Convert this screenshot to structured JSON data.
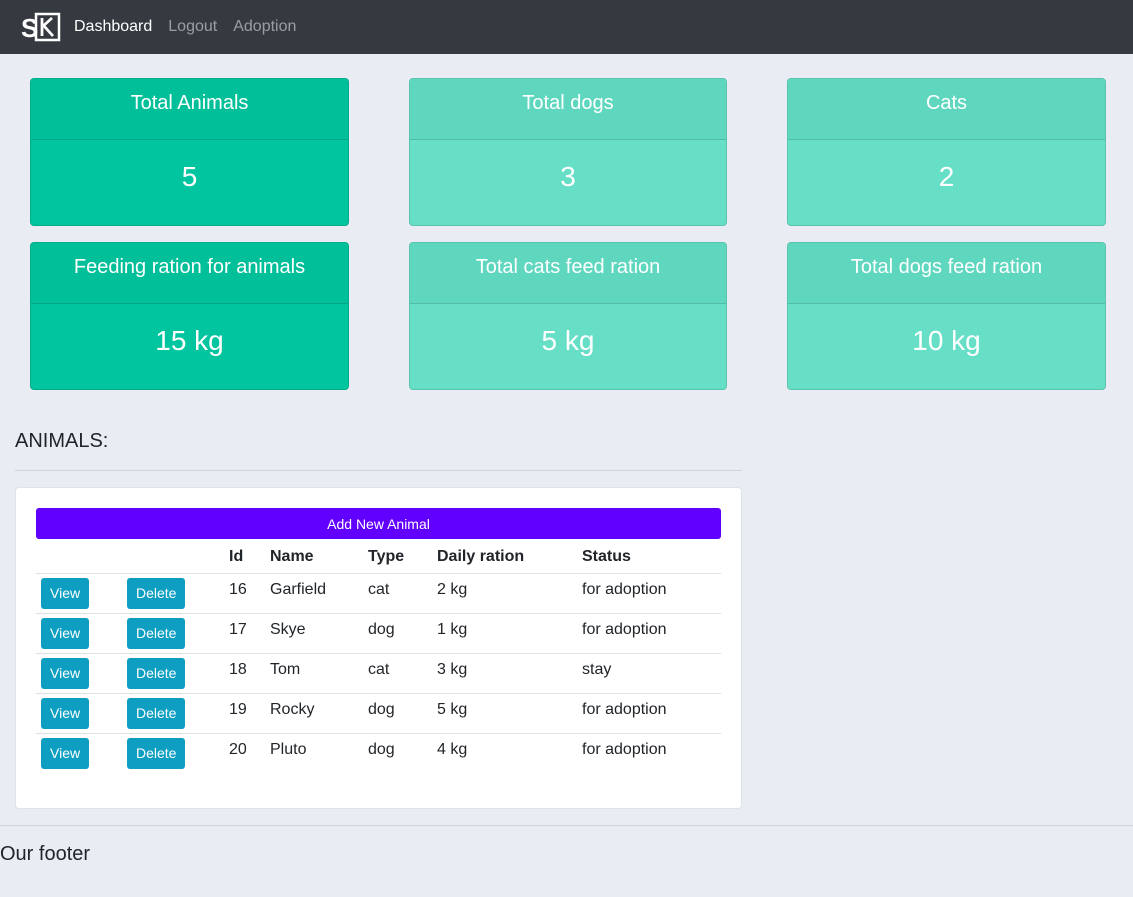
{
  "nav": {
    "brand_logo": "SK",
    "links": [
      {
        "label": "Dashboard",
        "active": true
      },
      {
        "label": "Logout",
        "active": false
      },
      {
        "label": "Adoption",
        "active": false
      }
    ]
  },
  "stats": [
    {
      "title": "Total Animals",
      "value": "5"
    },
    {
      "title": "Total dogs",
      "value": "3"
    },
    {
      "title": "Cats",
      "value": "2"
    },
    {
      "title": "Feeding ration for animals",
      "value": "15 kg"
    },
    {
      "title": "Total cats feed ration",
      "value": "5 kg"
    },
    {
      "title": "Total dogs feed ration",
      "value": "10 kg"
    }
  ],
  "animals_section": {
    "title": "ANIMALS:",
    "add_button": "Add New Animal",
    "columns": [
      "",
      "",
      "Id",
      "Name",
      "Type",
      "Daily ration",
      "Status"
    ],
    "view_label": "View",
    "delete_label": "Delete",
    "rows": [
      {
        "id": "16",
        "name": "Garfield",
        "type": "cat",
        "ration": "2 kg",
        "status": "for adoption"
      },
      {
        "id": "17",
        "name": "Skye",
        "type": "dog",
        "ration": "1 kg",
        "status": "for adoption"
      },
      {
        "id": "18",
        "name": "Tom",
        "type": "cat",
        "ration": "3 kg",
        "status": "stay"
      },
      {
        "id": "19",
        "name": "Rocky",
        "type": "dog",
        "ration": "5 kg",
        "status": "for adoption"
      },
      {
        "id": "20",
        "name": "Pluto",
        "type": "dog",
        "ration": "4 kg",
        "status": "for adoption"
      }
    ]
  },
  "footer": {
    "text": "Our footer"
  },
  "colors": {
    "navbar": "#343a40",
    "card_dark": "#00c59e",
    "card_light": "#67dfc7",
    "add_button": "#6200ff",
    "row_button": "#0e9ec2"
  }
}
